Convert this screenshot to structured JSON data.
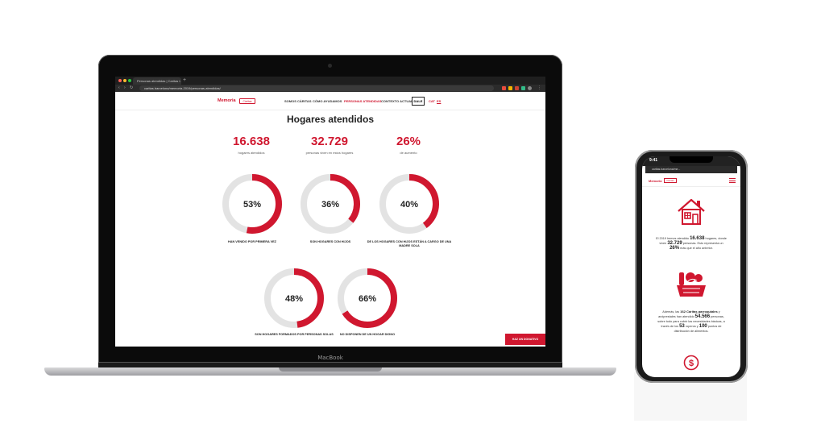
{
  "browser": {
    "tab_title": "Personas atendidas | Caritas I...",
    "url": "caritas.barcelona/memoria-2019/personas-atendidas/"
  },
  "site": {
    "logo_text": "Memoria",
    "logo_mark": "Càritas",
    "nav": [
      "SOMOS CÁRITAS",
      "CÓMO AYUDAMOS",
      "PERSONAS ATENDIDAS",
      "CONTEXTO ACTUAL"
    ],
    "nav_button": "DALE",
    "lang": [
      "CAT",
      "ES"
    ]
  },
  "page": {
    "title": "Hogares atendidos",
    "stats": [
      {
        "value": "16.638",
        "caption": "hogares atendidos"
      },
      {
        "value": "32.729",
        "caption": "personas viven en estos hogares"
      },
      {
        "value": "26%",
        "caption": "de aumento"
      }
    ],
    "donuts": [
      {
        "percent": 53,
        "label": "53%",
        "caption": "HAN VENIDO POR PRIMERA VEZ"
      },
      {
        "percent": 36,
        "label": "36%",
        "caption": "SON HOGARES CON HIJOS"
      },
      {
        "percent": 40,
        "label": "40%",
        "caption": "DE LOS HOGARES CON HIJOS ESTÁN A CARGO DE UNA MADRE SOLA"
      },
      {
        "percent": 48,
        "label": "48%",
        "caption": "SON HOGARES FORMADOS POR PERSONAS SOLAS"
      },
      {
        "percent": 66,
        "label": "66%",
        "caption": "NO DISPONEN DE UN HOGAR DIGNO"
      }
    ],
    "cta": "HAZ UN DONATIVO"
  },
  "laptop_label": "MacBook",
  "phone": {
    "time": "9:41",
    "url": "caritas.barcelona/me...",
    "logo_text": "Memoria",
    "logo_mark": "Càritas",
    "para1": {
      "pre": "El 2019 hemos atendido",
      "hogares": "16.638",
      "mid": "hogares, donde viven",
      "personas": "32.729",
      "mid2": "personas. Esto representa un",
      "pct": "26%",
      "post": "más que el año anterior."
    },
    "para2": {
      "pre": "Además, las",
      "caritas": "162 Cáritas parroquiales",
      "mid": "y arciprestales han atendido",
      "atendidas": "54.566",
      "mid2": "personas, sobre todo para cubrir las necesidades básicas, a través de los",
      "roperos": "53",
      "mid3": "roperos y",
      "puntos": "100",
      "post": "puntos de distribución de alimentos."
    }
  },
  "colors": {
    "accent": "#d0172f",
    "track": "#e3e3e3"
  }
}
